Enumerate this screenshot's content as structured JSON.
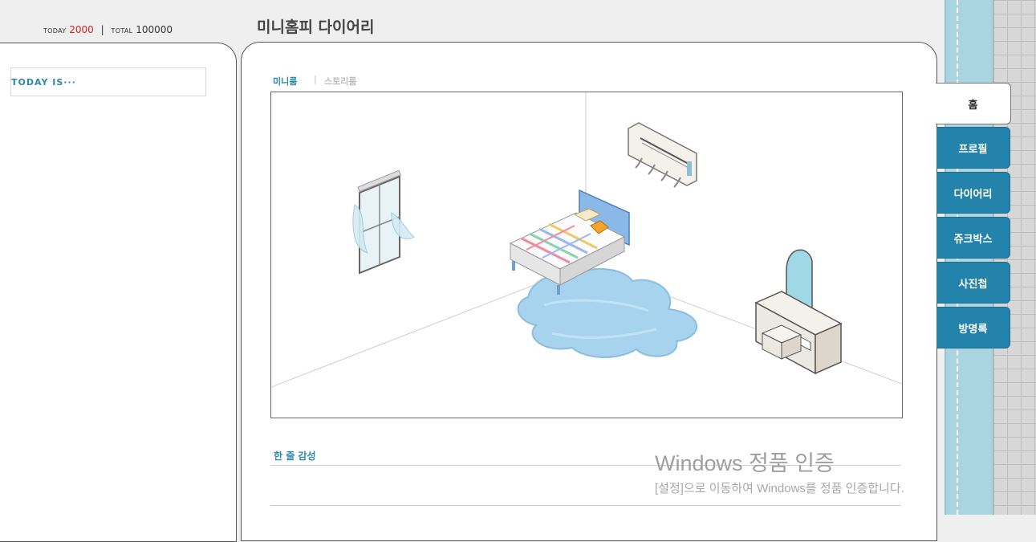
{
  "counter": {
    "today_label": "TODAY",
    "today_value": "2000",
    "separator": "|",
    "total_label": "TOTAL",
    "total_value": "100000"
  },
  "header": {
    "title": "미니홈피 다이어리"
  },
  "left_panel": {
    "today_is": "TODAY IS···"
  },
  "main": {
    "tabs": {
      "minimi": "미니룸",
      "separator": "|",
      "story": "스토리룸"
    },
    "one_line_title": "한 줄 감성"
  },
  "side_tabs": [
    {
      "label": "홈",
      "active": true
    },
    {
      "label": "프로필",
      "active": false
    },
    {
      "label": "다이어리",
      "active": false
    },
    {
      "label": "쥬크박스",
      "active": false
    },
    {
      "label": "사진첩",
      "active": false
    },
    {
      "label": "방명록",
      "active": false
    }
  ],
  "watermark": {
    "title": "Windows 정품 인증",
    "subtitle": "[설정]으로 이동하여 Windows를 정품 인증합니다."
  },
  "colors": {
    "accent": "#2383aa",
    "today_count": "#e01e1e",
    "strip": "#a9d4e0"
  },
  "icons": [
    "window-icon",
    "air-conditioner-icon",
    "bed-icon",
    "rug-icon",
    "vanity-icon"
  ]
}
